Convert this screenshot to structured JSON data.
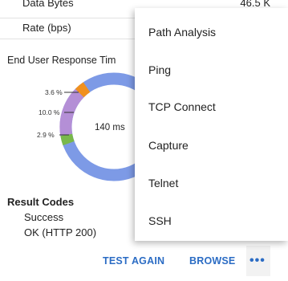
{
  "stats": {
    "data_bytes_label": "Data Bytes",
    "data_bytes_value": "46.5 K",
    "rate_label": "Rate (bps)"
  },
  "response": {
    "title": "End User Response Tim",
    "center_value": "140 ms",
    "labels": [
      "3.6 %",
      "10.0 %",
      "2.9 %"
    ]
  },
  "result_codes": {
    "title": "Result Codes",
    "status": "Success",
    "code": "OK (HTTP 200)"
  },
  "actions": {
    "test_again": "TEST AGAIN",
    "browse": "BROWSE",
    "more": "•••"
  },
  "menu": {
    "items": [
      "Path Analysis",
      "Ping",
      "TCP Connect",
      "Capture",
      "Telnet",
      "SSH"
    ]
  },
  "colors": {
    "accent": "#2b6cc4",
    "ring_main": "#7d9ae6",
    "ring_purple": "#b48fd6",
    "ring_orange": "#f0901e",
    "ring_green": "#79b84a"
  }
}
